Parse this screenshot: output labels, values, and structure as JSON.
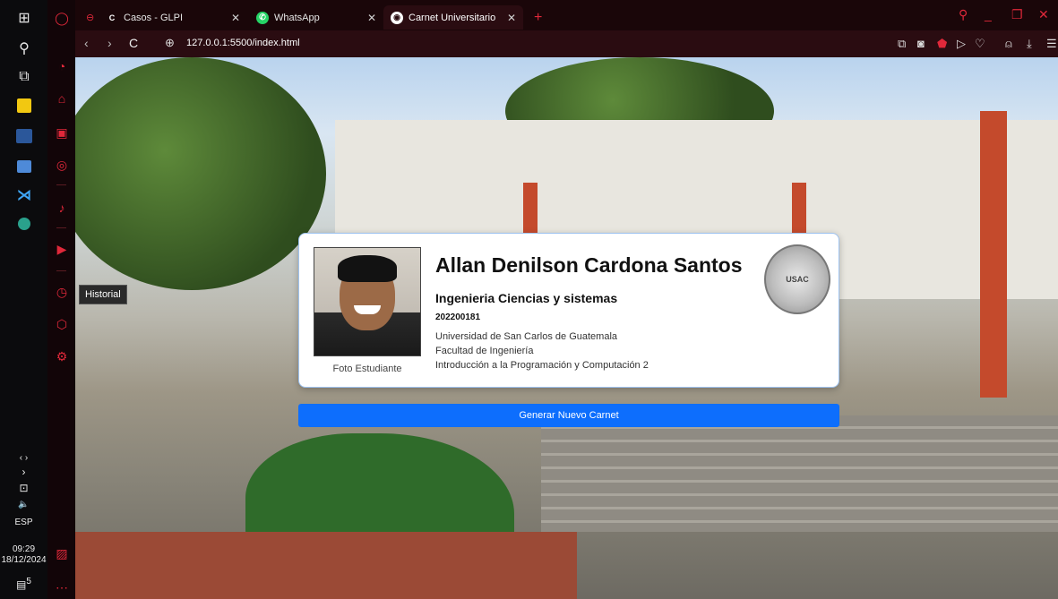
{
  "taskbar": {
    "language": "ESP",
    "time": "09:29",
    "date": "18/12/2024",
    "notification_count": "5"
  },
  "browser": {
    "tabs": [
      {
        "title": "Casos - GLPI",
        "icon": "glpi-icon"
      },
      {
        "title": "WhatsApp",
        "icon": "whatsapp-icon"
      },
      {
        "title": "Carnet Universitario",
        "icon": "globe-icon",
        "active": true
      }
    ],
    "url": "127.0.0.1:5500/index.html",
    "accent": "#e0283a"
  },
  "tooltip": {
    "text": "Historial"
  },
  "card": {
    "name": "Allan Denilson Cardona Santos",
    "career": "Ingenieria Ciencias y sistemas",
    "carnet": "202200181",
    "university": "Universidad de San Carlos de Guatemala",
    "faculty": "Facultad de Ingeniería",
    "course": "Introducción a la Programación y Computación 2",
    "photo_caption": "Foto Estudiante"
  },
  "button": {
    "label": "Generar Nuevo Carnet",
    "color": "#0d6efd"
  }
}
